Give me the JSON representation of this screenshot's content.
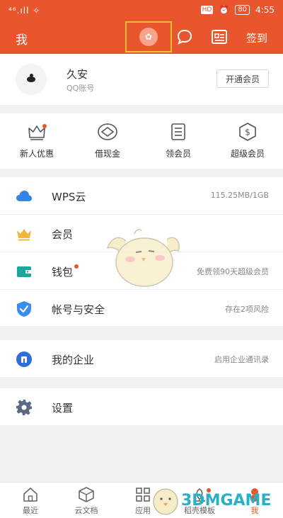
{
  "status_bar": {
    "left": "⁴⁶.ıll ✧",
    "hd": "HD",
    "battery": "80",
    "time": "4:55"
  },
  "app_bar": {
    "title": "我",
    "skin_glyph": "✿",
    "sign_in": "签到"
  },
  "profile": {
    "name": "久安",
    "account": "QQ账号",
    "vip_button": "开通会员"
  },
  "shortcuts": [
    {
      "label": "新人优惠",
      "icon": "crown-outline-icon",
      "badge": true
    },
    {
      "label": "借现金",
      "icon": "cash-diamond-icon",
      "badge": false
    },
    {
      "label": "领会员",
      "icon": "list-document-icon",
      "badge": false
    },
    {
      "label": "超级会员",
      "icon": "dollar-shield-icon",
      "badge": false
    }
  ],
  "menu": {
    "wps_cloud": {
      "label": "WPS云",
      "value": "115.25MB/1GB",
      "icon": "cloud-icon"
    },
    "membership": {
      "label": "会员",
      "value": "",
      "icon": "crown-icon"
    },
    "wallet": {
      "label": "钱包",
      "value": "免费领90天超级会员",
      "icon": "wallet-icon"
    },
    "security": {
      "label": "帐号与安全",
      "value": "存在2项风险",
      "icon": "shield-check-icon"
    },
    "enterprise": {
      "label": "我的企业",
      "value": "启用企业通讯录",
      "icon": "enterprise-icon"
    },
    "settings": {
      "label": "设置",
      "value": "",
      "icon": "gear-icon"
    }
  },
  "tabs": [
    {
      "label": "最近",
      "icon": "home-icon"
    },
    {
      "label": "云文档",
      "icon": "cube-icon"
    },
    {
      "label": "应用",
      "icon": "apps-grid-icon"
    },
    {
      "label": "稻壳模板",
      "icon": "template-icon",
      "badge": true
    },
    {
      "label": "我",
      "icon": "me-icon",
      "active": true
    }
  ],
  "watermark": "3DMGAME",
  "colors": {
    "accent": "#e9562d",
    "skin_highlight": "#f3c12e",
    "cloud_blue": "#2f86e8",
    "crown_gold": "#f3b63b",
    "wallet_teal": "#19a99a",
    "shield_blue": "#3a8df0",
    "gear_slate": "#5b6a82",
    "watermark_cyan": "#2ab0c6"
  }
}
